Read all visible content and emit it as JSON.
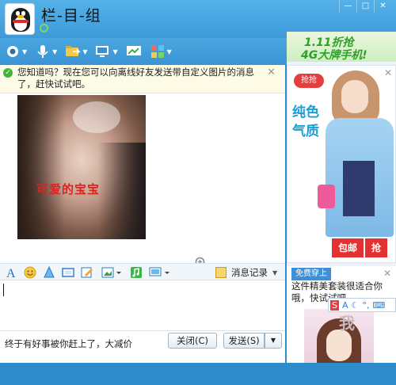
{
  "window": {
    "title": "栏-目-组",
    "min_label": "—",
    "max_label": "□",
    "close_label": "✕"
  },
  "toolbar": {
    "items": [
      {
        "icon": "video-call-icon"
      },
      {
        "icon": "voice-call-icon"
      },
      {
        "icon": "file-transfer-icon"
      },
      {
        "icon": "remote-desktop-icon"
      },
      {
        "icon": "screen-share-icon"
      },
      {
        "icon": "apps-icon"
      }
    ]
  },
  "notice": {
    "text": "您知道吗？现在您可以向离线好友发送带自定义图片的消息了，赶快试试吧。",
    "close_label": "✕"
  },
  "message": {
    "image_caption": "可爱的宝宝"
  },
  "ads": {
    "top_line1": "1.11折抢",
    "top_line2": "4G大牌手机!",
    "main_tag": "抢抢",
    "main_big_1": "纯色",
    "main_big_2": "气质",
    "main_btn_1": "包邮",
    "main_btn_2": "抢",
    "close_label": "✕",
    "bottom_tag": "免费穿上",
    "bottom_text": "这件精美套装很适合你哦，快试试吧",
    "bottom_pic_text": "我"
  },
  "ime": {
    "items": [
      "S",
      "A",
      "☾",
      "°,",
      "⌨"
    ]
  },
  "input_toolbar": {
    "history_label": "消息记录"
  },
  "bottom": {
    "status_text": "终于有好事被你赶上了，大减价",
    "close_button": "关闭(C)",
    "send_button": "发送(S)",
    "send_caret": "▼"
  },
  "colors": {
    "titlebar": "#4aa7e0",
    "accent_green": "#2fa02a",
    "accent_red": "#e33030"
  }
}
